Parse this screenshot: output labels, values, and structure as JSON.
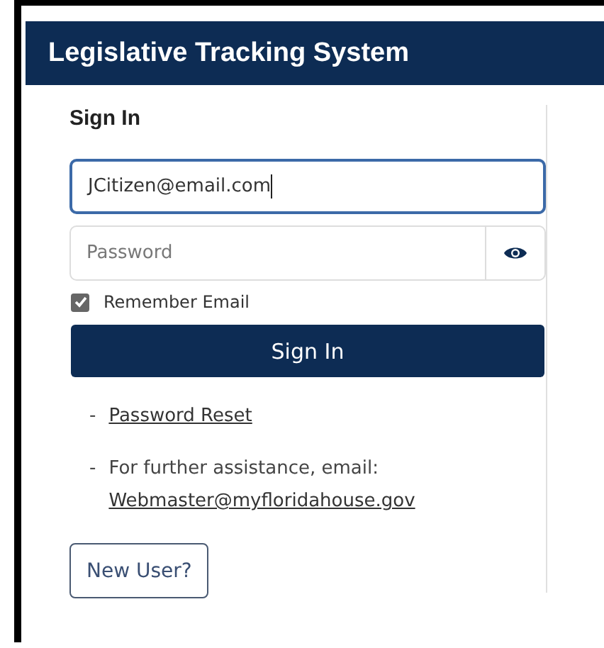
{
  "header": {
    "title": "Legislative Tracking System"
  },
  "form": {
    "title": "Sign In",
    "email": {
      "value": "JCitizen@email.com",
      "focused": true
    },
    "password": {
      "placeholder": "Password"
    },
    "remember": {
      "label": "Remember Email",
      "checked": true
    },
    "submit": "Sign In"
  },
  "links": [
    {
      "bullet": "-",
      "text": "Password Reset"
    },
    {
      "bullet": "-",
      "text": "For further assistance, email:",
      "link": "Webmaster@myfloridahouse.gov"
    }
  ],
  "new_user_button": "New User?"
}
